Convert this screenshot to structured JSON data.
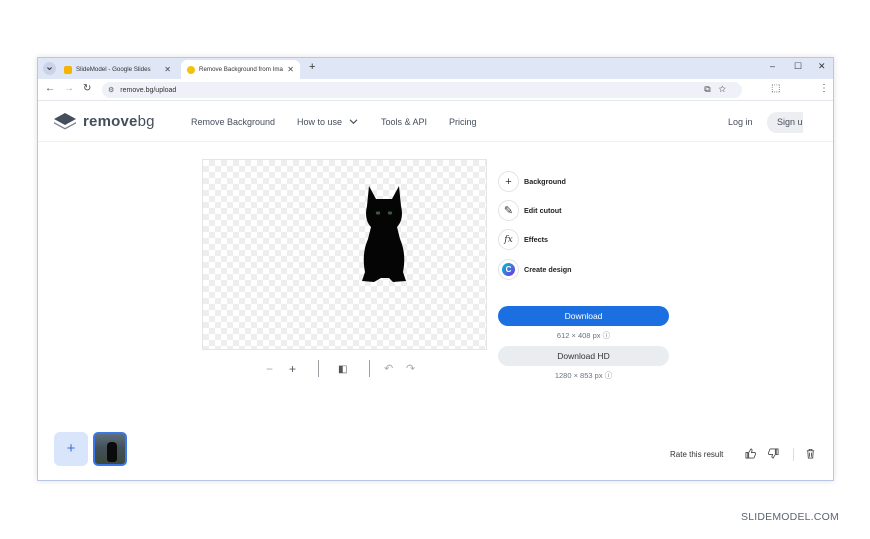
{
  "browser": {
    "tab_menu_icon": "chevron-down-icon",
    "tabs": [
      {
        "title": "SlideModel - Google Slides",
        "favicon_color": "#f4b400",
        "close": "✕"
      },
      {
        "title": "Remove Background from Imag",
        "favicon_color": "#f4c20d",
        "close": "✕"
      }
    ],
    "new_tab": "+",
    "window_controls": {
      "minimize": "–",
      "maximize": "☐",
      "close": "✕"
    },
    "url": "remove.bg/upload"
  },
  "site": {
    "logo": {
      "bold": "remove",
      "thin": "bg"
    },
    "nav": {
      "remove_background": "Remove Background",
      "how_to_use": "How to use",
      "tools_api": "Tools & API",
      "pricing": "Pricing"
    },
    "login": "Log in",
    "signup": "Sign up"
  },
  "editor": {
    "actions": [
      {
        "label": "Background",
        "icon": "plus-icon",
        "glyph": "+"
      },
      {
        "label": "Edit cutout",
        "icon": "magic-brush-icon",
        "glyph": "✎"
      },
      {
        "label": "Effects",
        "icon": "fx-icon",
        "glyph": "fx"
      },
      {
        "label": "Create design",
        "icon": "canva-icon",
        "glyph": "C"
      }
    ],
    "download": {
      "label": "Download",
      "size": "612 × 408 px ⓘ"
    },
    "download_hd": {
      "label": "Download HD",
      "size": "1280 × 853 px ⓘ"
    },
    "canvas_controls": {
      "zoom_out": "−",
      "zoom_in": "+",
      "compare": "◧",
      "undo": "↶",
      "redo": "↷"
    }
  },
  "footer": {
    "add_image": "+",
    "rate_label": "Rate this result",
    "thumbs_up": "👍",
    "thumbs_down": "👎",
    "delete": "🗑"
  },
  "watermark": "SLIDEMODEL.COM",
  "colors": {
    "accent": "#1b6fe0",
    "window_border": "#b9c7e6",
    "tabstrip": "#dfe6f6"
  }
}
